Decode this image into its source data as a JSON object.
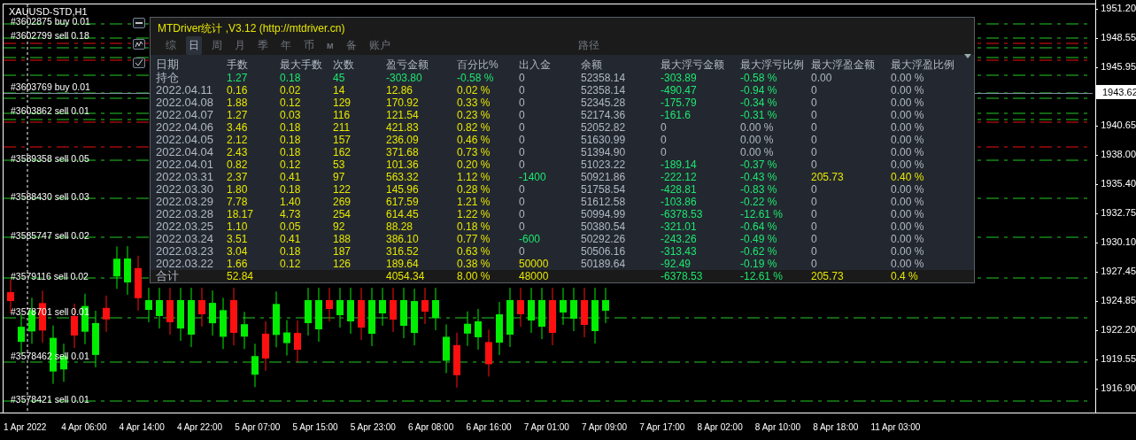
{
  "chart": {
    "symbol": "XAUUSD-STD,H1",
    "order_labels": [
      "#3602875 buy 0.01",
      "#3602799 sell 0.18",
      "#3603769 buy 0.01",
      "#3603862 sell 0.01",
      "#3589358 sell 0.05",
      "#3588430 sell 0.03",
      "#3585747 sell 0.02",
      "#3579116 sell 0.02",
      "#3578701 sell 0.01",
      "#3578462 sell 0.01",
      "#3578421 sell 0.01"
    ],
    "price_ticks": [
      "1951.20",
      "1948.55",
      "1945.95",
      "1940.65",
      "1938.00",
      "1935.40",
      "1932.75",
      "1930.10",
      "1927.45",
      "1924.85",
      "1922.20",
      "1919.55",
      "1916.90"
    ],
    "current_price": "1943.62",
    "time_ticks": [
      "1 Apr 2022",
      "4 Apr 06:00",
      "4 Apr 14:00",
      "4 Apr 22:00",
      "5 Apr 07:00",
      "5 Apr 15:00",
      "5 Apr 23:00",
      "6 Apr 08:00",
      "6 Apr 16:00",
      "7 Apr 01:00",
      "7 Apr 09:00",
      "7 Apr 17:00",
      "8 Apr 02:00",
      "8 Apr 10:00",
      "8 Apr 18:00",
      "11 Apr 03:00"
    ]
  },
  "panel": {
    "title": "MTDriver统计 ,V3.12 (http://mtdriver.cn)",
    "tabs": [
      {
        "label": "综",
        "selected": false
      },
      {
        "label": "日",
        "selected": true
      },
      {
        "label": "周",
        "selected": false
      },
      {
        "label": "月",
        "selected": false
      },
      {
        "label": "季",
        "selected": false
      },
      {
        "label": "年",
        "selected": false
      },
      {
        "label": "币",
        "selected": false
      },
      {
        "label": "M",
        "selected": false
      },
      {
        "label": "备",
        "selected": false
      },
      {
        "label": "账户",
        "selected": false
      }
    ],
    "path_label": "路径",
    "columns": [
      "日期",
      "手数",
      "最大手数",
      "次数",
      "盈亏金额",
      "百分比%",
      "出入金",
      "余额",
      "最大浮亏金额",
      "最大浮亏比例",
      "最大浮盈金额",
      "最大浮盈比例"
    ],
    "rows": [
      {
        "cells": [
          {
            "text": "持仓",
            "color": "#b0b8c4"
          },
          {
            "text": "1.27",
            "color": "#1de870"
          },
          {
            "text": "0.18",
            "color": "#1de870"
          },
          {
            "text": "45",
            "color": "#1de870"
          },
          {
            "text": "-303.80",
            "color": "#1de870"
          },
          {
            "text": "-0.58 %",
            "color": "#1de870"
          },
          {
            "text": "0",
            "color": "#b0b8c4"
          },
          {
            "text": "52358.14",
            "color": "#b0b8c4"
          },
          {
            "text": "-303.89",
            "color": "#1de870"
          },
          {
            "text": "-0.58 %",
            "color": "#1de870"
          },
          {
            "text": "0.00",
            "color": "#b0b8c4"
          },
          {
            "text": "0.00 %",
            "color": "#b0b8c4"
          }
        ]
      },
      {
        "cells": [
          {
            "text": "2022.04.11",
            "color": "#b0b8c4"
          },
          {
            "text": "0.16",
            "color": "#e6e600"
          },
          {
            "text": "0.02",
            "color": "#e6e600"
          },
          {
            "text": "14",
            "color": "#e6e600"
          },
          {
            "text": "12.86",
            "color": "#e6e600"
          },
          {
            "text": "0.02 %",
            "color": "#e6e600"
          },
          {
            "text": "0",
            "color": "#b0b8c4"
          },
          {
            "text": "52358.14",
            "color": "#b0b8c4"
          },
          {
            "text": "-490.47",
            "color": "#1de870"
          },
          {
            "text": "-0.94 %",
            "color": "#1de870"
          },
          {
            "text": "0",
            "color": "#b0b8c4"
          },
          {
            "text": "0.00 %",
            "color": "#b0b8c4"
          }
        ]
      },
      {
        "cells": [
          {
            "text": "2022.04.08",
            "color": "#b0b8c4"
          },
          {
            "text": "1.88",
            "color": "#e6e600"
          },
          {
            "text": "0.12",
            "color": "#e6e600"
          },
          {
            "text": "129",
            "color": "#e6e600"
          },
          {
            "text": "170.92",
            "color": "#e6e600"
          },
          {
            "text": "0.33 %",
            "color": "#e6e600"
          },
          {
            "text": "0",
            "color": "#b0b8c4"
          },
          {
            "text": "52345.28",
            "color": "#b0b8c4"
          },
          {
            "text": "-175.79",
            "color": "#1de870"
          },
          {
            "text": "-0.34 %",
            "color": "#1de870"
          },
          {
            "text": "0",
            "color": "#b0b8c4"
          },
          {
            "text": "0.00 %",
            "color": "#b0b8c4"
          }
        ]
      },
      {
        "cells": [
          {
            "text": "2022.04.07",
            "color": "#b0b8c4"
          },
          {
            "text": "1.27",
            "color": "#e6e600"
          },
          {
            "text": "0.03",
            "color": "#e6e600"
          },
          {
            "text": "116",
            "color": "#e6e600"
          },
          {
            "text": "121.54",
            "color": "#e6e600"
          },
          {
            "text": "0.23 %",
            "color": "#e6e600"
          },
          {
            "text": "0",
            "color": "#b0b8c4"
          },
          {
            "text": "52174.36",
            "color": "#b0b8c4"
          },
          {
            "text": "-161.6",
            "color": "#1de870"
          },
          {
            "text": "-0.31 %",
            "color": "#1de870"
          },
          {
            "text": "0",
            "color": "#b0b8c4"
          },
          {
            "text": "0.00 %",
            "color": "#b0b8c4"
          }
        ]
      },
      {
        "cells": [
          {
            "text": "2022.04.06",
            "color": "#b0b8c4"
          },
          {
            "text": "3.46",
            "color": "#e6e600"
          },
          {
            "text": "0.18",
            "color": "#e6e600"
          },
          {
            "text": "211",
            "color": "#e6e600"
          },
          {
            "text": "421.83",
            "color": "#e6e600"
          },
          {
            "text": "0.82 %",
            "color": "#e6e600"
          },
          {
            "text": "0",
            "color": "#b0b8c4"
          },
          {
            "text": "52052.82",
            "color": "#b0b8c4"
          },
          {
            "text": "0",
            "color": "#b0b8c4"
          },
          {
            "text": "0.00 %",
            "color": "#b0b8c4"
          },
          {
            "text": "0",
            "color": "#b0b8c4"
          },
          {
            "text": "0.00 %",
            "color": "#b0b8c4"
          }
        ]
      },
      {
        "cells": [
          {
            "text": "2022.04.05",
            "color": "#b0b8c4"
          },
          {
            "text": "2.12",
            "color": "#e6e600"
          },
          {
            "text": "0.18",
            "color": "#e6e600"
          },
          {
            "text": "157",
            "color": "#e6e600"
          },
          {
            "text": "236.09",
            "color": "#e6e600"
          },
          {
            "text": "0.46 %",
            "color": "#e6e600"
          },
          {
            "text": "0",
            "color": "#b0b8c4"
          },
          {
            "text": "51630.99",
            "color": "#b0b8c4"
          },
          {
            "text": "0",
            "color": "#b0b8c4"
          },
          {
            "text": "0.00 %",
            "color": "#b0b8c4"
          },
          {
            "text": "0",
            "color": "#b0b8c4"
          },
          {
            "text": "0.00 %",
            "color": "#b0b8c4"
          }
        ]
      },
      {
        "cells": [
          {
            "text": "2022.04.04",
            "color": "#b0b8c4"
          },
          {
            "text": "2.43",
            "color": "#e6e600"
          },
          {
            "text": "0.18",
            "color": "#e6e600"
          },
          {
            "text": "162",
            "color": "#e6e600"
          },
          {
            "text": "371.68",
            "color": "#e6e600"
          },
          {
            "text": "0.73 %",
            "color": "#e6e600"
          },
          {
            "text": "0",
            "color": "#b0b8c4"
          },
          {
            "text": "51394.90",
            "color": "#b0b8c4"
          },
          {
            "text": "0",
            "color": "#b0b8c4"
          },
          {
            "text": "0.00 %",
            "color": "#b0b8c4"
          },
          {
            "text": "0",
            "color": "#b0b8c4"
          },
          {
            "text": "0.00 %",
            "color": "#b0b8c4"
          }
        ]
      },
      {
        "cells": [
          {
            "text": "2022.04.01",
            "color": "#b0b8c4"
          },
          {
            "text": "0.82",
            "color": "#e6e600"
          },
          {
            "text": "0.12",
            "color": "#e6e600"
          },
          {
            "text": "53",
            "color": "#e6e600"
          },
          {
            "text": "101.36",
            "color": "#e6e600"
          },
          {
            "text": "0.20 %",
            "color": "#e6e600"
          },
          {
            "text": "0",
            "color": "#b0b8c4"
          },
          {
            "text": "51023.22",
            "color": "#b0b8c4"
          },
          {
            "text": "-189.14",
            "color": "#1de870"
          },
          {
            "text": "-0.37 %",
            "color": "#1de870"
          },
          {
            "text": "0",
            "color": "#b0b8c4"
          },
          {
            "text": "0.00 %",
            "color": "#b0b8c4"
          }
        ]
      },
      {
        "cells": [
          {
            "text": "2022.03.31",
            "color": "#b0b8c4"
          },
          {
            "text": "2.37",
            "color": "#e6e600"
          },
          {
            "text": "0.41",
            "color": "#e6e600"
          },
          {
            "text": "97",
            "color": "#e6e600"
          },
          {
            "text": "563.32",
            "color": "#e6e600"
          },
          {
            "text": "1.12 %",
            "color": "#e6e600"
          },
          {
            "text": "-1400",
            "color": "#1de870"
          },
          {
            "text": "50921.86",
            "color": "#b0b8c4"
          },
          {
            "text": "-222.12",
            "color": "#1de870"
          },
          {
            "text": "-0.43 %",
            "color": "#1de870"
          },
          {
            "text": "205.73",
            "color": "#e6e600"
          },
          {
            "text": "0.40 %",
            "color": "#e6e600"
          }
        ]
      },
      {
        "cells": [
          {
            "text": "2022.03.30",
            "color": "#b0b8c4"
          },
          {
            "text": "1.80",
            "color": "#e6e600"
          },
          {
            "text": "0.18",
            "color": "#e6e600"
          },
          {
            "text": "122",
            "color": "#e6e600"
          },
          {
            "text": "145.96",
            "color": "#e6e600"
          },
          {
            "text": "0.28 %",
            "color": "#e6e600"
          },
          {
            "text": "0",
            "color": "#b0b8c4"
          },
          {
            "text": "51758.54",
            "color": "#b0b8c4"
          },
          {
            "text": "-428.81",
            "color": "#1de870"
          },
          {
            "text": "-0.83 %",
            "color": "#1de870"
          },
          {
            "text": "0",
            "color": "#b0b8c4"
          },
          {
            "text": "0.00 %",
            "color": "#b0b8c4"
          }
        ]
      },
      {
        "cells": [
          {
            "text": "2022.03.29",
            "color": "#b0b8c4"
          },
          {
            "text": "7.78",
            "color": "#e6e600"
          },
          {
            "text": "1.40",
            "color": "#e6e600"
          },
          {
            "text": "269",
            "color": "#e6e600"
          },
          {
            "text": "617.59",
            "color": "#e6e600"
          },
          {
            "text": "1.21 %",
            "color": "#e6e600"
          },
          {
            "text": "0",
            "color": "#b0b8c4"
          },
          {
            "text": "51612.58",
            "color": "#b0b8c4"
          },
          {
            "text": "-103.86",
            "color": "#1de870"
          },
          {
            "text": "-0.22 %",
            "color": "#1de870"
          },
          {
            "text": "0",
            "color": "#b0b8c4"
          },
          {
            "text": "0.00 %",
            "color": "#b0b8c4"
          }
        ]
      },
      {
        "cells": [
          {
            "text": "2022.03.28",
            "color": "#b0b8c4"
          },
          {
            "text": "18.17",
            "color": "#e6e600"
          },
          {
            "text": "4.73",
            "color": "#e6e600"
          },
          {
            "text": "254",
            "color": "#e6e600"
          },
          {
            "text": "614.45",
            "color": "#e6e600"
          },
          {
            "text": "1.22 %",
            "color": "#e6e600"
          },
          {
            "text": "0",
            "color": "#b0b8c4"
          },
          {
            "text": "50994.99",
            "color": "#b0b8c4"
          },
          {
            "text": "-6378.53",
            "color": "#1de870"
          },
          {
            "text": "-12.61 %",
            "color": "#1de870"
          },
          {
            "text": "0",
            "color": "#b0b8c4"
          },
          {
            "text": "0.00 %",
            "color": "#b0b8c4"
          }
        ]
      },
      {
        "cells": [
          {
            "text": "2022.03.25",
            "color": "#b0b8c4"
          },
          {
            "text": "1.10",
            "color": "#e6e600"
          },
          {
            "text": "0.05",
            "color": "#e6e600"
          },
          {
            "text": "92",
            "color": "#e6e600"
          },
          {
            "text": "88.28",
            "color": "#e6e600"
          },
          {
            "text": "0.18 %",
            "color": "#e6e600"
          },
          {
            "text": "0",
            "color": "#b0b8c4"
          },
          {
            "text": "50380.54",
            "color": "#b0b8c4"
          },
          {
            "text": "-321.01",
            "color": "#1de870"
          },
          {
            "text": "-0.64 %",
            "color": "#1de870"
          },
          {
            "text": "0",
            "color": "#b0b8c4"
          },
          {
            "text": "0.00 %",
            "color": "#b0b8c4"
          }
        ]
      },
      {
        "cells": [
          {
            "text": "2022.03.24",
            "color": "#b0b8c4"
          },
          {
            "text": "3.51",
            "color": "#e6e600"
          },
          {
            "text": "0.41",
            "color": "#e6e600"
          },
          {
            "text": "188",
            "color": "#e6e600"
          },
          {
            "text": "386.10",
            "color": "#e6e600"
          },
          {
            "text": "0.77 %",
            "color": "#e6e600"
          },
          {
            "text": "-600",
            "color": "#1de870"
          },
          {
            "text": "50292.26",
            "color": "#b0b8c4"
          },
          {
            "text": "-243.26",
            "color": "#1de870"
          },
          {
            "text": "-0.49 %",
            "color": "#1de870"
          },
          {
            "text": "0",
            "color": "#b0b8c4"
          },
          {
            "text": "0.00 %",
            "color": "#b0b8c4"
          }
        ]
      },
      {
        "cells": [
          {
            "text": "2022.03.23",
            "color": "#b0b8c4"
          },
          {
            "text": "3.04",
            "color": "#e6e600"
          },
          {
            "text": "0.18",
            "color": "#e6e600"
          },
          {
            "text": "187",
            "color": "#e6e600"
          },
          {
            "text": "316.52",
            "color": "#e6e600"
          },
          {
            "text": "0.63 %",
            "color": "#e6e600"
          },
          {
            "text": "0",
            "color": "#b0b8c4"
          },
          {
            "text": "50506.16",
            "color": "#b0b8c4"
          },
          {
            "text": "-313.43",
            "color": "#1de870"
          },
          {
            "text": "-0.62 %",
            "color": "#1de870"
          },
          {
            "text": "0",
            "color": "#b0b8c4"
          },
          {
            "text": "0.00 %",
            "color": "#b0b8c4"
          }
        ]
      },
      {
        "cells": [
          {
            "text": "2022.03.22",
            "color": "#b0b8c4"
          },
          {
            "text": "1.66",
            "color": "#e6e600"
          },
          {
            "text": "0.12",
            "color": "#e6e600"
          },
          {
            "text": "126",
            "color": "#e6e600"
          },
          {
            "text": "189.64",
            "color": "#e6e600"
          },
          {
            "text": "0.38 %",
            "color": "#e6e600"
          },
          {
            "text": "50000",
            "color": "#e6e600"
          },
          {
            "text": "50189.64",
            "color": "#b0b8c4"
          },
          {
            "text": "-92.49",
            "color": "#1de870"
          },
          {
            "text": "-0.19 %",
            "color": "#1de870"
          },
          {
            "text": "0",
            "color": "#b0b8c4"
          },
          {
            "text": "0.00 %",
            "color": "#b0b8c4"
          }
        ]
      }
    ],
    "total": {
      "cells": [
        {
          "text": "合计",
          "color": "#b0b8c4"
        },
        {
          "text": "52.84",
          "color": "#e6e600"
        },
        null,
        null,
        {
          "text": "4054.34",
          "color": "#e6e600"
        },
        {
          "text": "8.00 %",
          "color": "#e6e600"
        },
        {
          "text": "48000",
          "color": "#e6e600"
        },
        null,
        {
          "text": "-6378.53",
          "color": "#1de870"
        },
        {
          "text": "-12.61 %",
          "color": "#1de870"
        },
        {
          "text": "205.73",
          "color": "#e6e600"
        },
        {
          "text": "0.4 %",
          "color": "#e6e600"
        }
      ]
    }
  }
}
